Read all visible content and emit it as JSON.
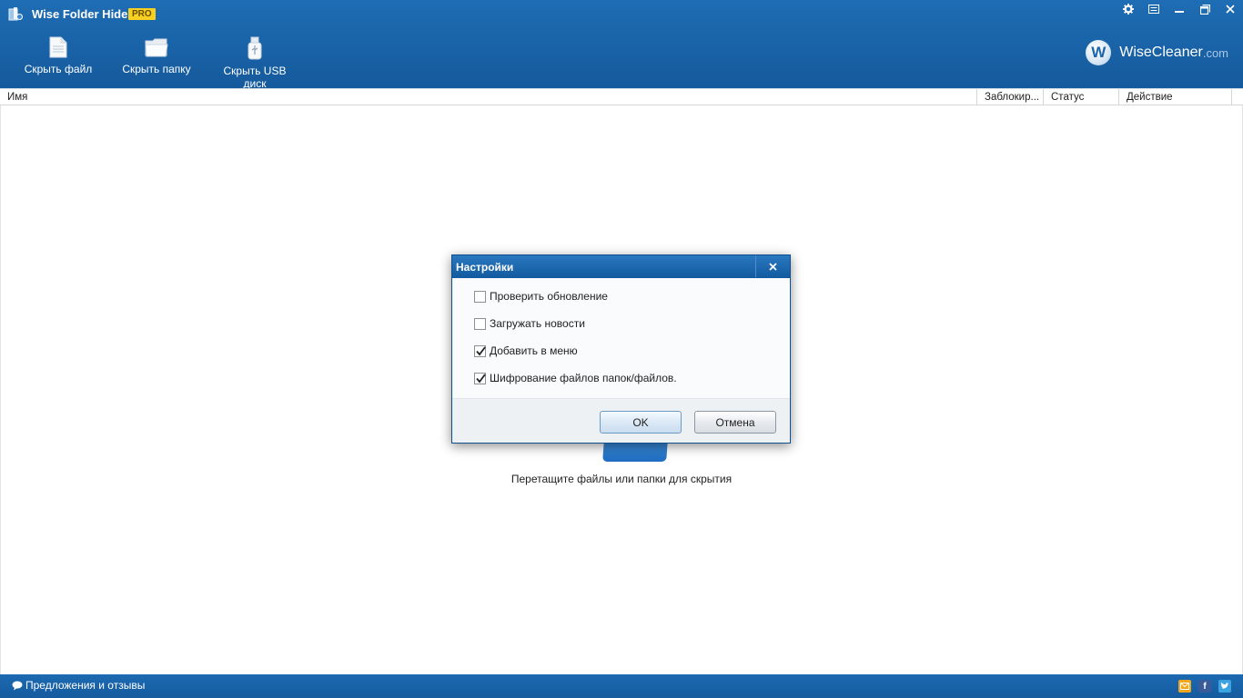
{
  "app": {
    "title": "Wise Folder Hider",
    "badge": "PRO",
    "brand_main": "WiseCleaner",
    "brand_suffix": ".com",
    "brand_initial": "W"
  },
  "toolbar": {
    "hide_file": "Скрыть файл",
    "hide_folder": "Скрыть папку",
    "hide_usb": "Скрыть USB диск"
  },
  "columns": {
    "name": "Имя",
    "locked": "Заблокир...",
    "status": "Статус",
    "action": "Действие"
  },
  "content": {
    "drop_hint": "Перетащите файлы или папки для скрытия"
  },
  "dialog": {
    "title": "Настройки",
    "options": [
      {
        "label": "Проверить обновление",
        "checked": false
      },
      {
        "label": "Загружать новости",
        "checked": false
      },
      {
        "label": "Добавить в меню",
        "checked": true
      },
      {
        "label": "Шифрование файлов папок/файлов.",
        "checked": true
      }
    ],
    "ok": "OK",
    "cancel": "Отмена"
  },
  "footer": {
    "feedback": "Предложения и отзывы",
    "social": [
      "mail-icon",
      "facebook-icon",
      "twitter-icon"
    ]
  },
  "colors": {
    "header_blue": "#1a64a9",
    "badge_yellow": "#f7d021"
  }
}
